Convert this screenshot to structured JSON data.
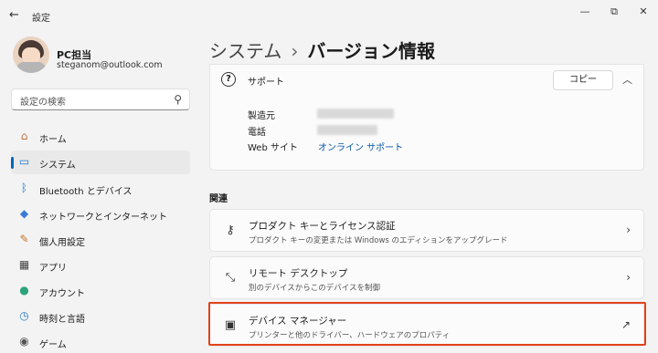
{
  "window": {
    "app_title": "設定",
    "back_label": "←",
    "minimize": "—",
    "maximize": "⧉",
    "close": "✕"
  },
  "profile": {
    "name": "PC担当",
    "email": "steganom@outlook.com"
  },
  "search": {
    "placeholder": "設定の検索",
    "icon": "search-icon"
  },
  "sidebar": {
    "items": [
      {
        "label": "ホーム",
        "icon": "home-icon",
        "glyph": "⌂",
        "color": "#c0703e",
        "active": false
      },
      {
        "label": "システム",
        "icon": "system-icon",
        "glyph": "▭",
        "color": "#1f78c8",
        "active": true
      },
      {
        "label": "Bluetooth とデバイス",
        "icon": "bluetooth-icon",
        "glyph": "ᛒ",
        "color": "#1f78c8",
        "active": false
      },
      {
        "label": "ネットワークとインターネット",
        "icon": "network-icon",
        "glyph": "◆",
        "color": "#3a7bd5",
        "active": false
      },
      {
        "label": "個人用設定",
        "icon": "brush-icon",
        "glyph": "✎",
        "color": "#c2732a",
        "active": false
      },
      {
        "label": "アプリ",
        "icon": "apps-icon",
        "glyph": "▦",
        "color": "#444444",
        "active": false
      },
      {
        "label": "アカウント",
        "icon": "account-icon",
        "glyph": "●",
        "color": "#2aa37a",
        "active": false
      },
      {
        "label": "時刻と言語",
        "icon": "time-language-icon",
        "glyph": "◷",
        "color": "#2b7fc1",
        "active": false
      },
      {
        "label": "ゲーム",
        "icon": "game-icon",
        "glyph": "◉",
        "color": "#555555",
        "active": false
      }
    ]
  },
  "breadcrumb": {
    "parent": "システム",
    "separator": "›",
    "current": "バージョン情報"
  },
  "support": {
    "title": "サポート",
    "copy_button": "コピー",
    "rows": [
      {
        "label": "製造元"
      },
      {
        "label": "電話"
      },
      {
        "label": "Web サイト",
        "value": "オンライン サポート"
      }
    ]
  },
  "related": {
    "heading": "関連",
    "items": [
      {
        "title": "プロダクト キーとライセンス認証",
        "subtitle": "プロダクト キーの変更または Windows のエディションをアップグレード",
        "icon": "key-icon",
        "glyph": "⚷",
        "action": "›"
      },
      {
        "title": "リモート デスクトップ",
        "subtitle": "別のデバイスからこのデバイスを制御",
        "icon": "remote-desktop-icon",
        "glyph": "⤡",
        "action": "›"
      },
      {
        "title": "デバイス マネージャー",
        "subtitle": "プリンターと他のドライバー、ハードウェアのプロパティ",
        "icon": "device-manager-icon",
        "glyph": "▣",
        "action": "↗"
      }
    ]
  },
  "colors": {
    "accent": "#0067c0",
    "highlight": "#e2421b",
    "link": "#0a56a8"
  }
}
